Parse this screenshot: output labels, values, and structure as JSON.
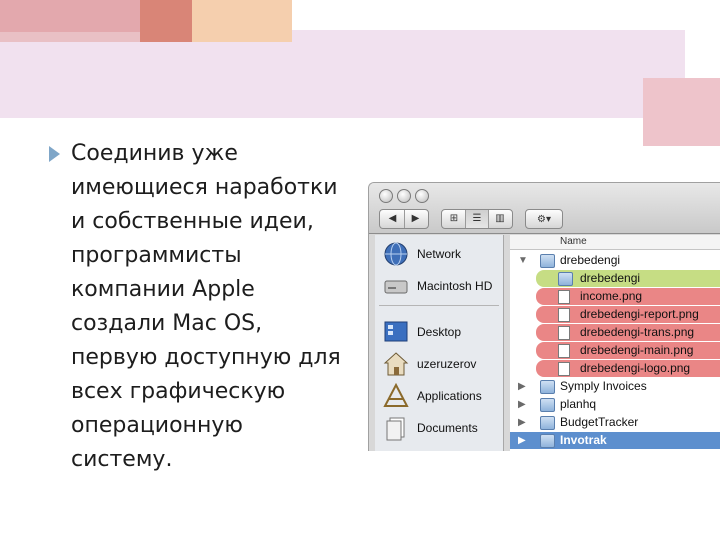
{
  "slide": {
    "text": "Соединив уже\nимеющиеся наработки\nи собственные идеи,\nпрограммисты\nкомпании Apple\nсоздали Mac OS,\nпервую доступную для\nвсех графическую\nоперационную\nсистему.",
    "colors": {
      "accent_pink": "#e3a8ad",
      "accent_salmon": "#d98577",
      "accent_peach": "#f5cfae",
      "band_lilac": "#f1e1ef",
      "bullet_blue": "#7fa6c8"
    }
  },
  "finder": {
    "toolbar": {
      "back": "◀",
      "forward": "▶",
      "view_icons": "⊞",
      "view_list": "☰",
      "view_columns": "▥",
      "action": "⚙▾"
    },
    "sidebar": [
      {
        "label": "Network",
        "icon": "network-globe-icon"
      },
      {
        "label": "Macintosh HD",
        "icon": "hard-drive-icon"
      },
      {
        "label": "Desktop",
        "icon": "desktop-icon"
      },
      {
        "label": "uzeruzerov",
        "icon": "home-icon"
      },
      {
        "label": "Applications",
        "icon": "applications-icon"
      },
      {
        "label": "Documents",
        "icon": "documents-icon"
      }
    ],
    "list": {
      "column_header": "Name",
      "rows": [
        {
          "label": "drebedengi",
          "kind": "folder",
          "expanded": true,
          "highlight": "none"
        },
        {
          "label": "drebedengi",
          "kind": "folder",
          "highlight": "green"
        },
        {
          "label": "income.png",
          "kind": "file",
          "highlight": "red"
        },
        {
          "label": "drebedengi-report.png",
          "kind": "file",
          "highlight": "red"
        },
        {
          "label": "drebedengi-trans.png",
          "kind": "file",
          "highlight": "red"
        },
        {
          "label": "drebedengi-main.png",
          "kind": "file",
          "highlight": "red"
        },
        {
          "label": "drebedengi-logo.png",
          "kind": "file",
          "highlight": "red"
        },
        {
          "label": "Symply Invoices",
          "kind": "folder",
          "highlight": "none"
        },
        {
          "label": "planhq",
          "kind": "folder",
          "highlight": "none"
        },
        {
          "label": "BudgetTracker",
          "kind": "folder",
          "highlight": "none"
        },
        {
          "label": "Invotrak",
          "kind": "folder",
          "highlight": "selected"
        }
      ]
    }
  }
}
